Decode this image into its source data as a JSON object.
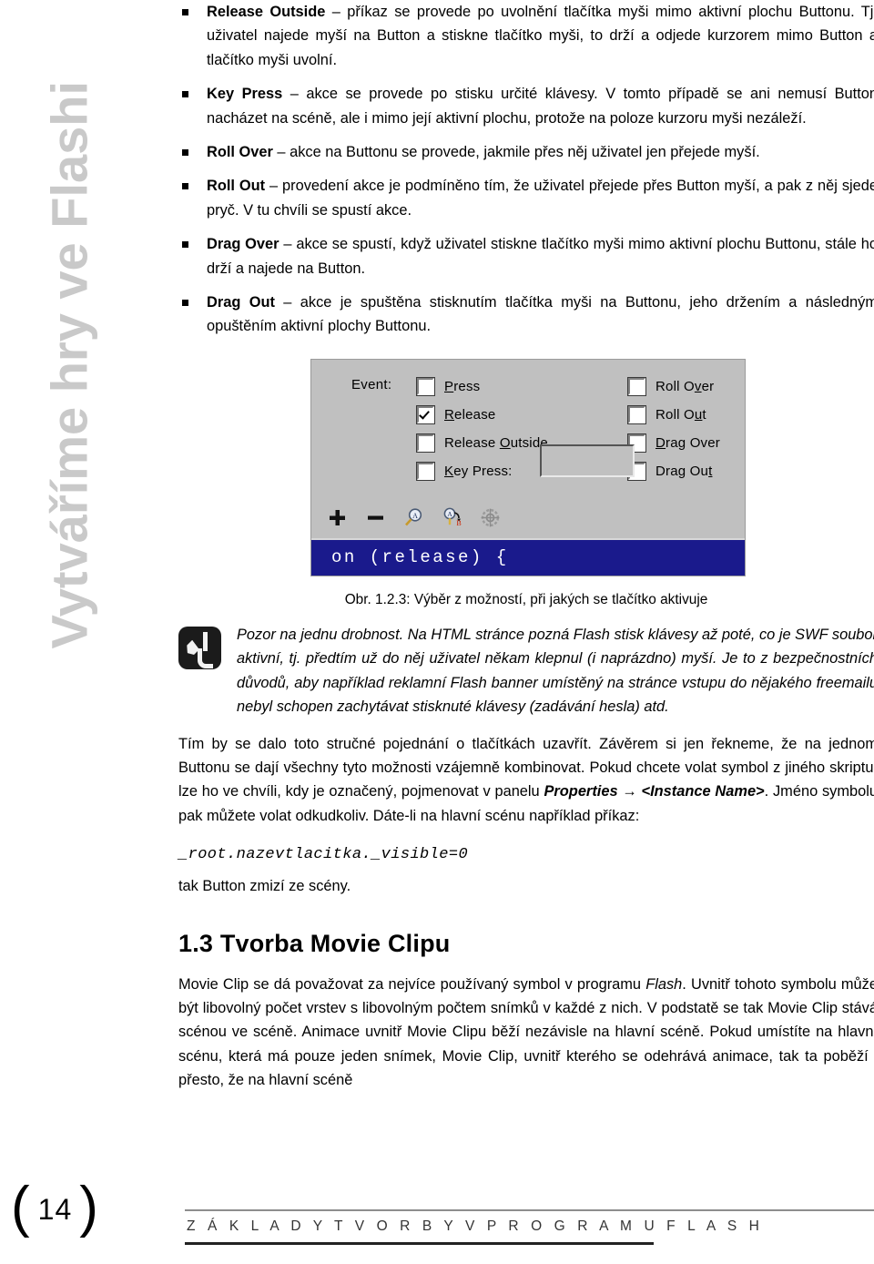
{
  "side_title": "Vytváříme hry ve Flashi",
  "bullets": [
    {
      "term": "Release Outside",
      "text": " – příkaz se provede po uvolnění tlačítka myši mimo aktivní plochu Buttonu. Tj. uživatel najede myší na Button a stiskne tlačítko myši, to drží a odjede kurzorem mimo Button a tlačítko myši uvolní."
    },
    {
      "term": "Key Press",
      "text": " – akce se provede po stisku určité klávesy. V tomto případě se ani nemusí Button nacházet na scéně, ale i mimo její aktivní plochu, protože na poloze kurzoru myši nezáleží."
    },
    {
      "term": "Roll Over",
      "text": " – akce na Buttonu se provede, jakmile přes něj uživatel jen přejede myší."
    },
    {
      "term": "Roll Out",
      "text": " – provedení akce je podmíněno tím, že uživatel přejede přes Button myší, a pak z něj sjede pryč. V tu chvíli se spustí akce."
    },
    {
      "term": "Drag Over",
      "text": " – akce se spustí, když uživatel stiskne tlačítko myši mimo aktivní plochu Buttonu, stále ho drží a najede na Button."
    },
    {
      "term": "Drag Out",
      "text": " – akce je spuštěna stisknutím tlačítka myši na Buttonu, jeho držením a následným opuštěním aktivní plochy Buttonu."
    }
  ],
  "figure": {
    "event_label": "Event:",
    "left_column": [
      {
        "label_pre": "",
        "label_key": "P",
        "label_post": "ress",
        "checked": false
      },
      {
        "label_pre": "",
        "label_key": "R",
        "label_post": "elease",
        "checked": true
      },
      {
        "label_pre": "Release ",
        "label_key": "O",
        "label_post": "utside",
        "checked": false
      },
      {
        "label_pre": "",
        "label_key": "K",
        "label_post": "ey Press:",
        "checked": false
      }
    ],
    "right_column": [
      {
        "label_pre": "Roll O",
        "label_key": "v",
        "label_post": "er",
        "checked": false
      },
      {
        "label_pre": "Roll O",
        "label_key": "u",
        "label_post": "t",
        "checked": false
      },
      {
        "label_pre": "",
        "label_key": "D",
        "label_post": "rag Over",
        "checked": false
      },
      {
        "label_pre": "Drag Ou",
        "label_key": "t",
        "label_post": "",
        "checked": false
      }
    ],
    "key_press_value": "",
    "tools": [
      "plus-icon",
      "minus-icon",
      "find-icon",
      "replace-icon",
      "target-icon"
    ],
    "code": "on (release) {",
    "colors": {
      "dialog_bg": "#c0c0c0",
      "code_bg": "#1a1a8c",
      "code_fg": "#ffffff"
    }
  },
  "caption": "Obr. 1.2.3: Výběr z možností, při jakých se tlačítko aktivuje",
  "note": {
    "icon": "pencil-note-icon",
    "text": "Pozor na jednu drobnost. Na HTML stránce pozná Flash stisk klávesy až poté, co je SWF soubor aktivní, tj. předtím už do něj uživatel někam klepnul (i naprázdno) myší. Je to z bezpečnostních důvodů, aby například reklamní Flash banner umístěný na stránce vstupu do nějakého freemailu nebyl schopen zachytávat stisknuté klávesy (zadávání hesla) atd."
  },
  "paragraph_1": {
    "part_a": "Tím by se dalo toto stručné pojednání o tlačítkách uzavřít. Závěrem si jen řekneme, že na jednom Buttonu se dají všechny tyto možnosti vzájemně kombinovat. Pokud chcete volat symbol z jiného skriptu, lze ho ve chvíli, kdy je označený, pojmenovat v panelu ",
    "emph_a": "Properties",
    "arrow": " → ",
    "emph_b": "<Instance Name>",
    "part_b": ". Jméno symbolu pak můžete volat odkudkoliv. Dáte-li na hlavní scénu například příkaz:"
  },
  "code_line": "_root.nazevtlacitka._visible=0",
  "paragraph_2": "tak Button zmizí ze scény.",
  "section_heading": "1.3 Tvorba Movie Clipu",
  "paragraph_3": {
    "part_a": "Movie Clip se dá považovat za nejvíce používaný symbol v programu ",
    "emph": "Flash",
    "part_b": ". Uvnitř tohoto symbolu může být libovolný počet vrstev s libovolným počtem snímků v každé z nich. V podstatě se tak Movie Clip stává scénou ve scéně. Animace uvnitř Movie Clipu běží nezávisle na hlavní scéně. Pokud umístíte na hlavní scénu, která má pouze jeden snímek, Movie Clip, uvnitř kterého se odehrává animace, tak ta poběží i přesto, že na hlavní scéně"
  },
  "footer": {
    "bracket_left": "(",
    "page_number": "14",
    "bracket_right": ")",
    "running_text": "Z Á K L A D Y   T V O R B Y   V   P R O G R A M U   F L A S H"
  }
}
